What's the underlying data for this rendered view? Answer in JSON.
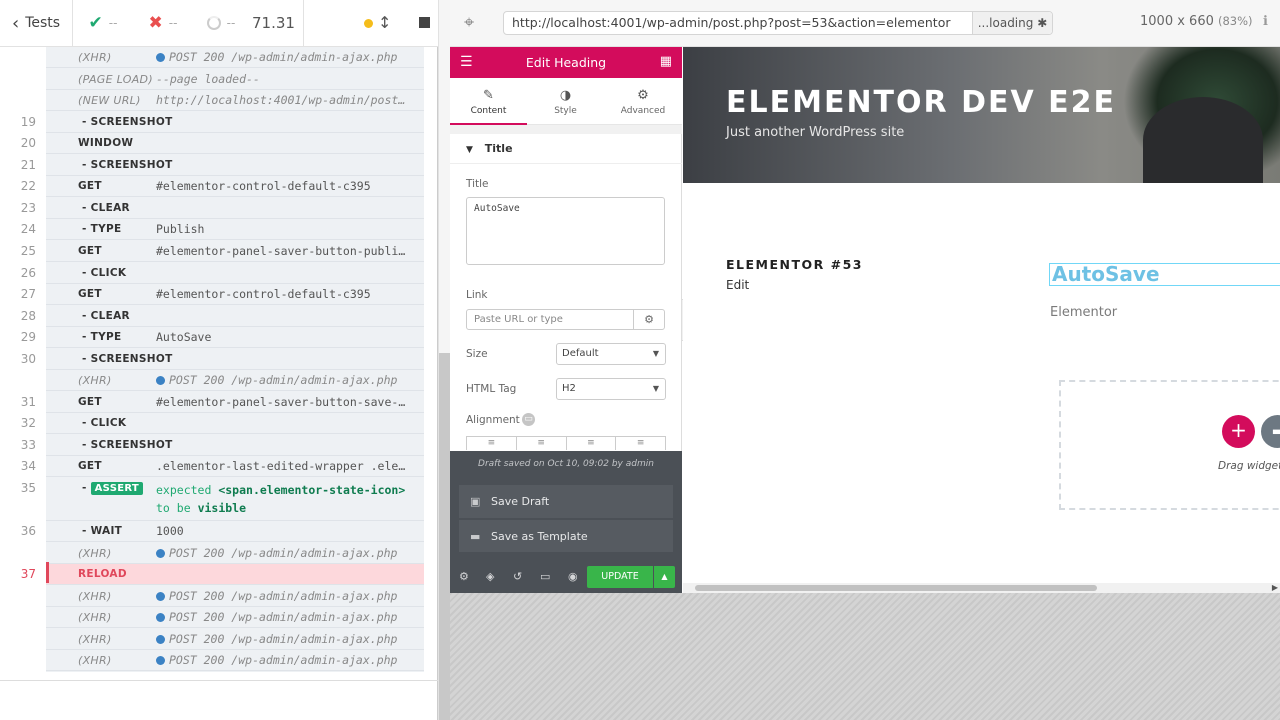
{
  "reporter": {
    "tests_label": "Tests",
    "passed": "--",
    "failed": "--",
    "pending": "--",
    "duration": "71.31"
  },
  "commands": [
    {
      "num": "",
      "name": "(XHR)",
      "kind": "paren",
      "msg": "POST 200 /wp-admin/admin-ajax.php",
      "xhr": true
    },
    {
      "num": "",
      "name": "(PAGE LOAD)",
      "kind": "paren",
      "msg": "--page loaded--",
      "xhr": false
    },
    {
      "num": "",
      "name": "(NEW URL)",
      "kind": "paren",
      "msg": "http://localhost:4001/wp-admin/post…",
      "xhr": false
    },
    {
      "num": "19",
      "name": "- SCREENSHOT",
      "kind": "sub",
      "msg": ""
    },
    {
      "num": "20",
      "name": "WINDOW",
      "kind": "main",
      "msg": ""
    },
    {
      "num": "21",
      "name": "- SCREENSHOT",
      "kind": "sub",
      "msg": ""
    },
    {
      "num": "22",
      "name": "GET",
      "kind": "main",
      "msg": "#elementor-control-default-c395"
    },
    {
      "num": "23",
      "name": "- CLEAR",
      "kind": "sub",
      "msg": ""
    },
    {
      "num": "24",
      "name": "- TYPE",
      "kind": "sub",
      "msg": "Publish"
    },
    {
      "num": "25",
      "name": "GET",
      "kind": "main",
      "msg": "#elementor-panel-saver-button-publi…"
    },
    {
      "num": "26",
      "name": "- CLICK",
      "kind": "sub",
      "msg": ""
    },
    {
      "num": "27",
      "name": "GET",
      "kind": "main",
      "msg": "#elementor-control-default-c395"
    },
    {
      "num": "28",
      "name": "- CLEAR",
      "kind": "sub",
      "msg": ""
    },
    {
      "num": "29",
      "name": "- TYPE",
      "kind": "sub",
      "msg": "AutoSave"
    },
    {
      "num": "30",
      "name": "- SCREENSHOT",
      "kind": "sub",
      "msg": ""
    },
    {
      "num": "",
      "name": "(XHR)",
      "kind": "paren",
      "msg": "POST 200 /wp-admin/admin-ajax.php",
      "xhr": true
    },
    {
      "num": "31",
      "name": "GET",
      "kind": "main",
      "msg": "#elementor-panel-saver-button-save-…"
    },
    {
      "num": "32",
      "name": "- CLICK",
      "kind": "sub",
      "msg": ""
    },
    {
      "num": "33",
      "name": "- SCREENSHOT",
      "kind": "sub",
      "msg": ""
    },
    {
      "num": "34",
      "name": "GET",
      "kind": "main",
      "msg": ".elementor-last-edited-wrapper .ele…"
    }
  ],
  "assert_cmd": {
    "num": "35",
    "dash": "-",
    "badge": "ASSERT",
    "expected": "expected",
    "subject": "<span.elementor-state-icon>",
    "to_be": "to be",
    "state": "visible"
  },
  "commands_after": [
    {
      "num": "36",
      "name": "- WAIT",
      "kind": "sub",
      "msg": "1000"
    },
    {
      "num": "",
      "name": "(XHR)",
      "kind": "paren",
      "msg": "POST 200 /wp-admin/admin-ajax.php",
      "xhr": true
    },
    {
      "num": "37",
      "name": "RELOAD",
      "kind": "reload",
      "msg": ""
    },
    {
      "num": "",
      "name": "(XHR)",
      "kind": "paren",
      "msg": "POST 200 /wp-admin/admin-ajax.php",
      "xhr": true
    },
    {
      "num": "",
      "name": "(XHR)",
      "kind": "paren",
      "msg": "POST 200 /wp-admin/admin-ajax.php",
      "xhr": true
    },
    {
      "num": "",
      "name": "(XHR)",
      "kind": "paren",
      "msg": "POST 200 /wp-admin/admin-ajax.php",
      "xhr": true
    },
    {
      "num": "",
      "name": "(XHR)",
      "kind": "paren",
      "msg": "POST 200 /wp-admin/admin-ajax.php",
      "xhr": true
    }
  ],
  "aut": {
    "url": "http://localhost:4001/wp-admin/post.php?post=53&action=elementor",
    "loading": "...loading",
    "viewport": "1000 x 660",
    "scale": "(83%)"
  },
  "panel": {
    "title": "Edit Heading",
    "tabs": [
      "Content",
      "Style",
      "Advanced"
    ],
    "section": "Title",
    "title_label": "Title",
    "title_value": "AutoSave",
    "link_label": "Link",
    "link_placeholder": "Paste URL or type",
    "size_label": "Size",
    "size_value": "Default",
    "tag_label": "HTML Tag",
    "tag_value": "H2",
    "align_label": "Alignment",
    "saver_note": "Draft saved on Oct 10, 09:02 by admin",
    "save_draft": "Save Draft",
    "save_template": "Save as Template",
    "update": "UPDATE"
  },
  "preview": {
    "site_title": "ELEMENTOR DEV E2E",
    "site_desc": "Just another WordPress site",
    "post_title": "ELEMENTOR #53",
    "edit": "Edit",
    "heading": "AutoSave",
    "text": "Elementor",
    "drag_text": "Drag widget h"
  },
  "colors": {
    "elementor_pink": "#d30c5c",
    "cypress_green": "#1fa971",
    "fail_red": "#e94f4f",
    "update_green": "#39b54a",
    "heading_blue": "#6ec1e4"
  }
}
